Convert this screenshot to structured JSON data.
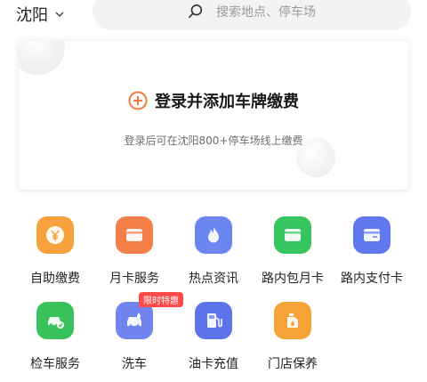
{
  "header": {
    "city": "沈阳",
    "search_placeholder": "搜索地点、停车场"
  },
  "login_card": {
    "title": "登录并添加车牌缴费",
    "subtitle": "登录后可在沈阳800+停车场线上缴费"
  },
  "services": [
    {
      "label": "自助缴费",
      "icon": "yen-icon",
      "color": "#f7a23c"
    },
    {
      "label": "月卡服务",
      "icon": "card-icon",
      "color": "#f47e47"
    },
    {
      "label": "热点资讯",
      "icon": "flame-icon",
      "color": "#6b86ee"
    },
    {
      "label": "路内包月卡",
      "icon": "wallet-icon",
      "color": "#35c45e"
    },
    {
      "label": "路内支付卡",
      "icon": "payment-card-icon",
      "color": "#5f78f0"
    },
    {
      "label": "检车服务",
      "icon": "car-check-icon",
      "color": "#37c25c"
    },
    {
      "label": "洗车",
      "icon": "car-wash-icon",
      "color": "#6f84ee",
      "badge": "限时特惠"
    },
    {
      "label": "油卡充值",
      "icon": "fuel-pump-icon",
      "color": "#5c73ea"
    },
    {
      "label": "门店保养",
      "icon": "oil-can-icon",
      "color": "#f5a236"
    }
  ]
}
